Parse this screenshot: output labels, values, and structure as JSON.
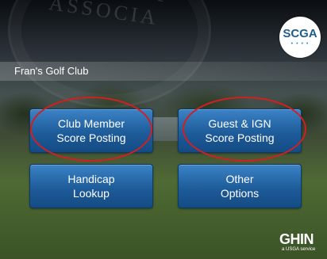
{
  "header": {
    "club_name": "Fran's Golf Club"
  },
  "logo": {
    "text": "SCGA",
    "icon": "scga-dots-logo"
  },
  "seal": {
    "text": "TES GOLF ASSOCIA"
  },
  "buttons": {
    "club_member": "Club Member\nScore Posting",
    "guest_ign": "Guest & IGN\nScore Posting",
    "handicap_lookup": "Handicap\nLookup",
    "other_options": "Other\nOptions"
  },
  "footer": {
    "brand": "GHIN",
    "sub": "a USGA service"
  },
  "colors": {
    "button": "#1e5c9a",
    "highlight": "#d21f1f"
  }
}
